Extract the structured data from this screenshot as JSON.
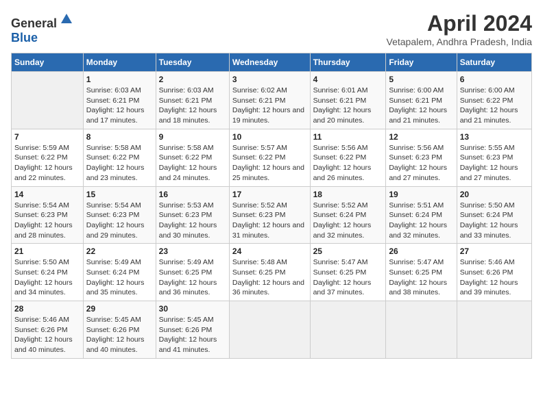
{
  "logo": {
    "text_general": "General",
    "text_blue": "Blue"
  },
  "title": "April 2024",
  "subtitle": "Vetapalem, Andhra Pradesh, India",
  "days_of_week": [
    "Sunday",
    "Monday",
    "Tuesday",
    "Wednesday",
    "Thursday",
    "Friday",
    "Saturday"
  ],
  "weeks": [
    [
      {
        "day": "",
        "sunrise": "",
        "sunset": "",
        "daylight": ""
      },
      {
        "day": "1",
        "sunrise": "Sunrise: 6:03 AM",
        "sunset": "Sunset: 6:21 PM",
        "daylight": "Daylight: 12 hours and 17 minutes."
      },
      {
        "day": "2",
        "sunrise": "Sunrise: 6:03 AM",
        "sunset": "Sunset: 6:21 PM",
        "daylight": "Daylight: 12 hours and 18 minutes."
      },
      {
        "day": "3",
        "sunrise": "Sunrise: 6:02 AM",
        "sunset": "Sunset: 6:21 PM",
        "daylight": "Daylight: 12 hours and 19 minutes."
      },
      {
        "day": "4",
        "sunrise": "Sunrise: 6:01 AM",
        "sunset": "Sunset: 6:21 PM",
        "daylight": "Daylight: 12 hours and 20 minutes."
      },
      {
        "day": "5",
        "sunrise": "Sunrise: 6:00 AM",
        "sunset": "Sunset: 6:21 PM",
        "daylight": "Daylight: 12 hours and 21 minutes."
      },
      {
        "day": "6",
        "sunrise": "Sunrise: 6:00 AM",
        "sunset": "Sunset: 6:22 PM",
        "daylight": "Daylight: 12 hours and 21 minutes."
      }
    ],
    [
      {
        "day": "7",
        "sunrise": "Sunrise: 5:59 AM",
        "sunset": "Sunset: 6:22 PM",
        "daylight": "Daylight: 12 hours and 22 minutes."
      },
      {
        "day": "8",
        "sunrise": "Sunrise: 5:58 AM",
        "sunset": "Sunset: 6:22 PM",
        "daylight": "Daylight: 12 hours and 23 minutes."
      },
      {
        "day": "9",
        "sunrise": "Sunrise: 5:58 AM",
        "sunset": "Sunset: 6:22 PM",
        "daylight": "Daylight: 12 hours and 24 minutes."
      },
      {
        "day": "10",
        "sunrise": "Sunrise: 5:57 AM",
        "sunset": "Sunset: 6:22 PM",
        "daylight": "Daylight: 12 hours and 25 minutes."
      },
      {
        "day": "11",
        "sunrise": "Sunrise: 5:56 AM",
        "sunset": "Sunset: 6:22 PM",
        "daylight": "Daylight: 12 hours and 26 minutes."
      },
      {
        "day": "12",
        "sunrise": "Sunrise: 5:56 AM",
        "sunset": "Sunset: 6:23 PM",
        "daylight": "Daylight: 12 hours and 27 minutes."
      },
      {
        "day": "13",
        "sunrise": "Sunrise: 5:55 AM",
        "sunset": "Sunset: 6:23 PM",
        "daylight": "Daylight: 12 hours and 27 minutes."
      }
    ],
    [
      {
        "day": "14",
        "sunrise": "Sunrise: 5:54 AM",
        "sunset": "Sunset: 6:23 PM",
        "daylight": "Daylight: 12 hours and 28 minutes."
      },
      {
        "day": "15",
        "sunrise": "Sunrise: 5:54 AM",
        "sunset": "Sunset: 6:23 PM",
        "daylight": "Daylight: 12 hours and 29 minutes."
      },
      {
        "day": "16",
        "sunrise": "Sunrise: 5:53 AM",
        "sunset": "Sunset: 6:23 PM",
        "daylight": "Daylight: 12 hours and 30 minutes."
      },
      {
        "day": "17",
        "sunrise": "Sunrise: 5:52 AM",
        "sunset": "Sunset: 6:23 PM",
        "daylight": "Daylight: 12 hours and 31 minutes."
      },
      {
        "day": "18",
        "sunrise": "Sunrise: 5:52 AM",
        "sunset": "Sunset: 6:24 PM",
        "daylight": "Daylight: 12 hours and 32 minutes."
      },
      {
        "day": "19",
        "sunrise": "Sunrise: 5:51 AM",
        "sunset": "Sunset: 6:24 PM",
        "daylight": "Daylight: 12 hours and 32 minutes."
      },
      {
        "day": "20",
        "sunrise": "Sunrise: 5:50 AM",
        "sunset": "Sunset: 6:24 PM",
        "daylight": "Daylight: 12 hours and 33 minutes."
      }
    ],
    [
      {
        "day": "21",
        "sunrise": "Sunrise: 5:50 AM",
        "sunset": "Sunset: 6:24 PM",
        "daylight": "Daylight: 12 hours and 34 minutes."
      },
      {
        "day": "22",
        "sunrise": "Sunrise: 5:49 AM",
        "sunset": "Sunset: 6:24 PM",
        "daylight": "Daylight: 12 hours and 35 minutes."
      },
      {
        "day": "23",
        "sunrise": "Sunrise: 5:49 AM",
        "sunset": "Sunset: 6:25 PM",
        "daylight": "Daylight: 12 hours and 36 minutes."
      },
      {
        "day": "24",
        "sunrise": "Sunrise: 5:48 AM",
        "sunset": "Sunset: 6:25 PM",
        "daylight": "Daylight: 12 hours and 36 minutes."
      },
      {
        "day": "25",
        "sunrise": "Sunrise: 5:47 AM",
        "sunset": "Sunset: 6:25 PM",
        "daylight": "Daylight: 12 hours and 37 minutes."
      },
      {
        "day": "26",
        "sunrise": "Sunrise: 5:47 AM",
        "sunset": "Sunset: 6:25 PM",
        "daylight": "Daylight: 12 hours and 38 minutes."
      },
      {
        "day": "27",
        "sunrise": "Sunrise: 5:46 AM",
        "sunset": "Sunset: 6:26 PM",
        "daylight": "Daylight: 12 hours and 39 minutes."
      }
    ],
    [
      {
        "day": "28",
        "sunrise": "Sunrise: 5:46 AM",
        "sunset": "Sunset: 6:26 PM",
        "daylight": "Daylight: 12 hours and 40 minutes."
      },
      {
        "day": "29",
        "sunrise": "Sunrise: 5:45 AM",
        "sunset": "Sunset: 6:26 PM",
        "daylight": "Daylight: 12 hours and 40 minutes."
      },
      {
        "day": "30",
        "sunrise": "Sunrise: 5:45 AM",
        "sunset": "Sunset: 6:26 PM",
        "daylight": "Daylight: 12 hours and 41 minutes."
      },
      {
        "day": "",
        "sunrise": "",
        "sunset": "",
        "daylight": ""
      },
      {
        "day": "",
        "sunrise": "",
        "sunset": "",
        "daylight": ""
      },
      {
        "day": "",
        "sunrise": "",
        "sunset": "",
        "daylight": ""
      },
      {
        "day": "",
        "sunrise": "",
        "sunset": "",
        "daylight": ""
      }
    ]
  ]
}
